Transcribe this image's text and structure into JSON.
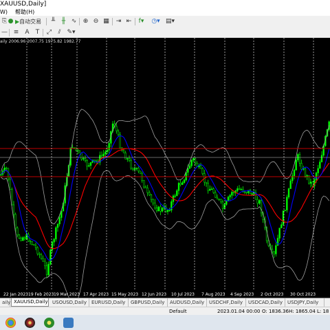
{
  "window": {
    "title": "XAUUSD,Daily]"
  },
  "menu": {
    "items": [
      "W)",
      "帮助(H)"
    ]
  },
  "toolbar": {
    "auto_trading_label": "自动交易"
  },
  "chart": {
    "ohlc_text": "aily 2006.96 2007.75 1975.82 1982.77",
    "colors": {
      "candle": "#00ff00",
      "ma_red": "#ff0000",
      "ma_blue": "#0000ff",
      "bands": "#a0a0a0",
      "hline": "#c00000",
      "vline": "#ffffff"
    },
    "dates": [
      "22 Jan 2023",
      "19 Feb 2023",
      "19 Mar 2023",
      "17 Apr 2023",
      "15 May 2023",
      "12 Jun 2023",
      "10 Jul 2023",
      "7 Aug 2023",
      "4 Sep 2023",
      "2 Oct 2023",
      "30 Oct 2023"
    ]
  },
  "tabs": [
    "aily",
    "XAUUSD,Daily",
    "USOUSD,Daily",
    "EURUSD,Daily",
    "GBPUSD,Daily",
    "AUDUSD,Daily",
    "USDCHF,Daily",
    "USDCAD,Daily",
    "USDJPY,Daily"
  ],
  "status": {
    "profile": "Default",
    "datetime": "2023.01.04 00:00",
    "open": "O: 1836.36",
    "high": "H: 1865.04",
    "low": "L: 18"
  },
  "taskbar": {
    "icons": [
      "chrome-icon",
      "ball-icon",
      "terminal-icon"
    ]
  }
}
